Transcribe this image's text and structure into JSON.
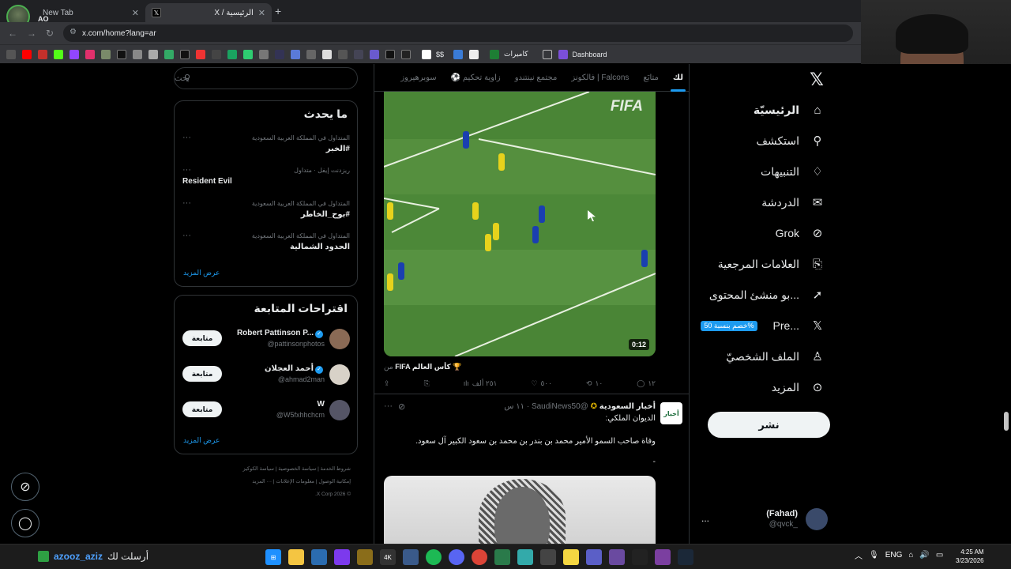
{
  "browser": {
    "tabs": [
      {
        "title": "New Tab",
        "close": "✕"
      },
      {
        "title": "X / الرئيسية",
        "close": "✕"
      }
    ],
    "new_tab": "+",
    "profile_label": "AO",
    "url": "x.com/home?lang=ar",
    "bookmarks_text": [
      {
        "label": "كاميرات"
      },
      {
        "label": "Dashboard"
      },
      {
        "label": "$$"
      }
    ]
  },
  "nav": {
    "items": [
      {
        "label": "الرئيسيّة",
        "icon": "home-icon"
      },
      {
        "label": "استكشف",
        "icon": "search-icon"
      },
      {
        "label": "التنبيهات",
        "icon": "bell-icon"
      },
      {
        "label": "الدردشة",
        "icon": "mail-icon"
      },
      {
        "label": "Grok",
        "icon": "grok-icon"
      },
      {
        "label": "العلامات المرجعية",
        "icon": "bookmark-icon"
      },
      {
        "label": "...بو منشئ المحتوى",
        "icon": "rocket-icon"
      },
      {
        "label": "...Pre",
        "icon": "x-icon"
      },
      {
        "label": "الملف الشخصيّ",
        "icon": "person-icon"
      },
      {
        "label": "المزيد",
        "icon": "more-icon"
      }
    ],
    "premium_badge": "%خصم بنسبة 50",
    "post_button": "نشر",
    "profile": {
      "name": "(Fahad)",
      "handle": "@qvck_",
      "menu": "..."
    }
  },
  "feed": {
    "tabs": [
      "لك",
      "متابَع",
      "فالكونز | Falcons",
      "مجتمع نينتندو",
      "⚽ زاوية تحكيم",
      "سوبرهيروز"
    ],
    "active_tab": 0,
    "video": {
      "watermark": "FIFA",
      "duration": "0:12",
      "source_prefix": "من",
      "source_name": "FIFA كأس العالم 🏆"
    },
    "actions": {
      "replies": "١٢",
      "reposts": "١٠",
      "likes": "٥٠٠",
      "views": "٢٥١ ألف"
    },
    "tweet2": {
      "name": "أخبار السعودية",
      "handle": "@SaudiNews50",
      "time": "١١ س",
      "avatar_text": "أخبار",
      "line1": "الديوان الملكي:",
      "line2": "وفاة صاحب السمو الأمير محمد بن بندر بن محمد بن سعود الكبير آل سعود.",
      "line3": "-"
    }
  },
  "sidebar": {
    "search_placeholder": "بحث",
    "trends_title": "ما يحدث",
    "trends": [
      {
        "meta": "المتداول في المملكة العربية السعودية",
        "name": "#الخبر"
      },
      {
        "meta": "ريزدنت إيفل · متداول",
        "name": "Resident Evil"
      },
      {
        "meta": "المتداول في المملكة العربية السعودية",
        "name": "#بوح_الخاطر"
      },
      {
        "meta": "المتداول في المملكة العربية السعودية",
        "name": "الحدود الشمالية"
      }
    ],
    "show_more": "عرض المزيد",
    "follow_title": "اقتراحات المتابعة",
    "follow": [
      {
        "name": "Robert Pattinson P...",
        "handle": "@pattinsonphotos",
        "button": "متابعة"
      },
      {
        "name": "أحمد العجلان",
        "handle": "@ahmad2man",
        "button": "متابعة"
      },
      {
        "name": "W",
        "handle": "@W5fxhhchcm",
        "button": "متابعة"
      }
    ],
    "follow_show_more": "عرض المزيد",
    "footer": {
      "l1": "شروط الخدمة | سياسة الخصوصية | سياسة الكوكيز",
      "l2": "إمكانية الوصول | معلومات الإعلانات | ··· المزيد",
      "l3": "© 2026 X Corp."
    }
  },
  "taskbar": {
    "user": "azooz_aziz",
    "message": "أرسلت لك",
    "lang": "ENG",
    "time": "4:25 AM",
    "date": "3/23/2026"
  },
  "colors": {
    "accent": "#1d9bf0",
    "background": "#000000",
    "text": "#e7e9ea",
    "muted": "#71767b",
    "border": "#2f3336"
  }
}
